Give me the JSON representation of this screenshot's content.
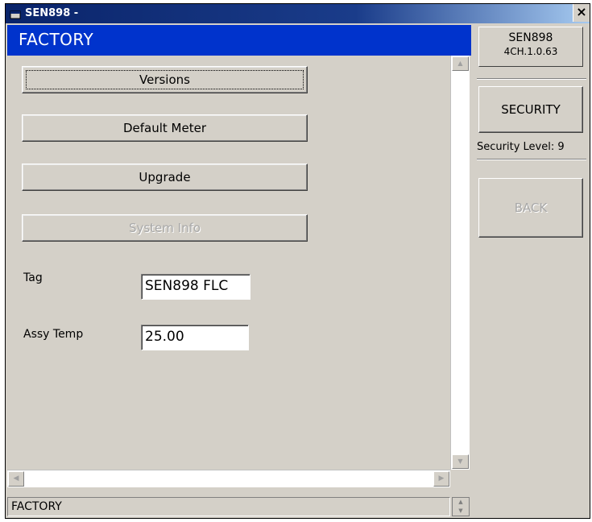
{
  "window": {
    "title": "SEN898 -",
    "close_glyph": "×"
  },
  "header": {
    "title": "FACTORY"
  },
  "buttons": {
    "versions": "Versions",
    "default_meter": "Default Meter",
    "upgrade": "Upgrade",
    "system_info": "System Info"
  },
  "fields": {
    "tag": {
      "label": "Tag",
      "value": "SEN898  FLC"
    },
    "assy_temp": {
      "label": "Assy Temp",
      "value": "25.00"
    }
  },
  "status": {
    "text": "FACTORY"
  },
  "right_panel": {
    "model": "SEN898",
    "version": "4CH.1.0.63",
    "security_button": "SECURITY",
    "security_level": "Security Level: 9",
    "back_button": "BACK"
  },
  "icons": {
    "app": "app-window-icon",
    "close": "close-icon",
    "scroll_up": "arrow-up-icon",
    "scroll_down": "arrow-down-icon",
    "scroll_left": "arrow-left-icon",
    "scroll_right": "arrow-right-icon"
  },
  "colors": {
    "header_bg": "#0033cc",
    "face": "#d4d0c8",
    "title_text": "#ffffff"
  }
}
